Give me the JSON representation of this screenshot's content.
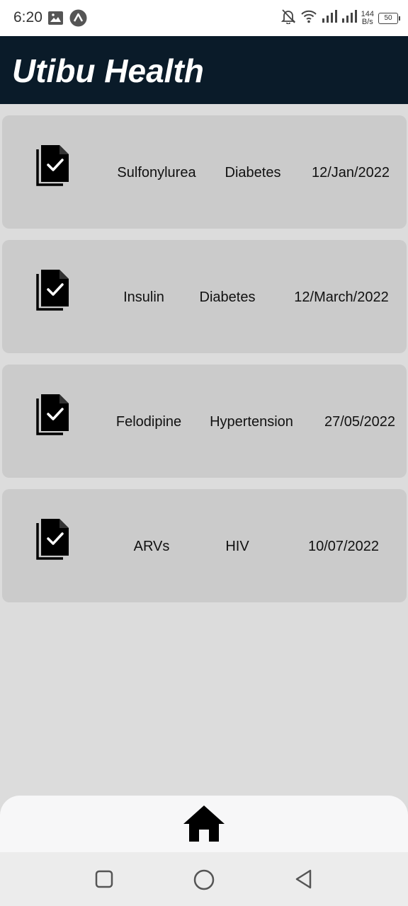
{
  "status_bar": {
    "time": "6:20",
    "net_speed_value": "144",
    "net_speed_unit": "B/s",
    "battery": "50",
    "icons": [
      "image-icon",
      "app-a-icon",
      "bell-off-icon",
      "wifi-icon",
      "signal-icon",
      "signal-icon"
    ]
  },
  "app_bar": {
    "title": "Utibu Health"
  },
  "medications": [
    {
      "name": "Sulfonylurea",
      "condition": "Diabetes",
      "date": "12/Jan/2022",
      "icon": "prescription-check-icon"
    },
    {
      "name": "Insulin",
      "condition": "Diabetes",
      "date": "12/March/2022",
      "icon": "prescription-check-icon"
    },
    {
      "name": "Felodipine",
      "condition": "Hypertension",
      "date": "27/05/2022",
      "icon": "prescription-check-icon"
    },
    {
      "name": "ARVs",
      "condition": "HIV",
      "date": "10/07/2022",
      "icon": "prescription-check-icon"
    }
  ],
  "bottom_nav": {
    "icon": "home-icon"
  },
  "system_nav": {
    "icons": [
      "recents-icon",
      "home-circle-icon",
      "back-icon"
    ]
  },
  "colors": {
    "app_bar": "#0a1b29",
    "background": "#dcdcdc",
    "card": "#cbcbcb"
  }
}
